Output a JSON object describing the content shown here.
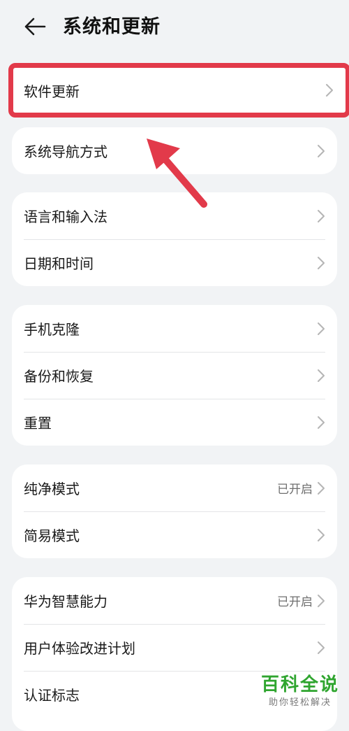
{
  "header": {
    "title": "系统和更新"
  },
  "highlight": {
    "label": "软件更新",
    "color": "#e23a4a"
  },
  "groups": [
    {
      "items": [
        {
          "label": "系统导航方式",
          "status": ""
        }
      ]
    },
    {
      "items": [
        {
          "label": "语言和输入法",
          "status": ""
        },
        {
          "label": "日期和时间",
          "status": ""
        }
      ]
    },
    {
      "items": [
        {
          "label": "手机克隆",
          "status": ""
        },
        {
          "label": "备份和恢复",
          "status": ""
        },
        {
          "label": "重置",
          "status": ""
        }
      ]
    },
    {
      "items": [
        {
          "label": "纯净模式",
          "status": "已开启"
        },
        {
          "label": "简易模式",
          "status": ""
        }
      ]
    },
    {
      "items": [
        {
          "label": "华为智慧能力",
          "status": "已开启"
        },
        {
          "label": "用户体验改进计划",
          "status": ""
        },
        {
          "label": "认证标志",
          "status": ""
        }
      ]
    }
  ],
  "watermark": {
    "title": "百科全说",
    "subtitle": "助你轻松解决"
  },
  "icons": {
    "back": "arrow-left-icon",
    "chevron": "chevron-right-icon"
  }
}
